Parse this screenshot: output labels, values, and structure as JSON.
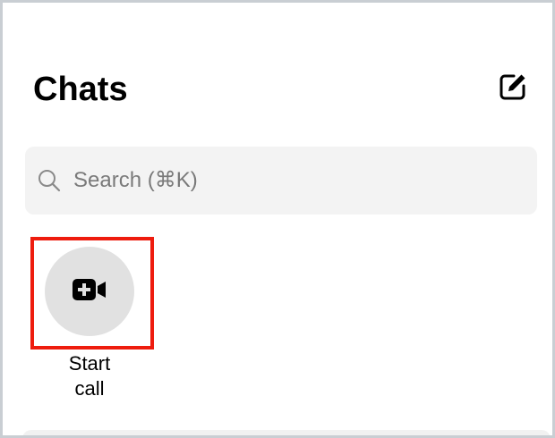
{
  "header": {
    "title": "Chats",
    "compose_icon": "compose-icon"
  },
  "search": {
    "placeholder": "Search (⌘K)",
    "icon": "search-icon"
  },
  "quick_actions": {
    "start_call": {
      "label_line1": "Start",
      "label_line2": "call",
      "icon": "video-call-add-icon",
      "highlight_color": "#ee1c0e"
    }
  },
  "colors": {
    "background": "#ffffff",
    "search_background": "#f3f3f3",
    "action_circle": "#e1e1e1",
    "frame_border": "#c9ced3"
  }
}
